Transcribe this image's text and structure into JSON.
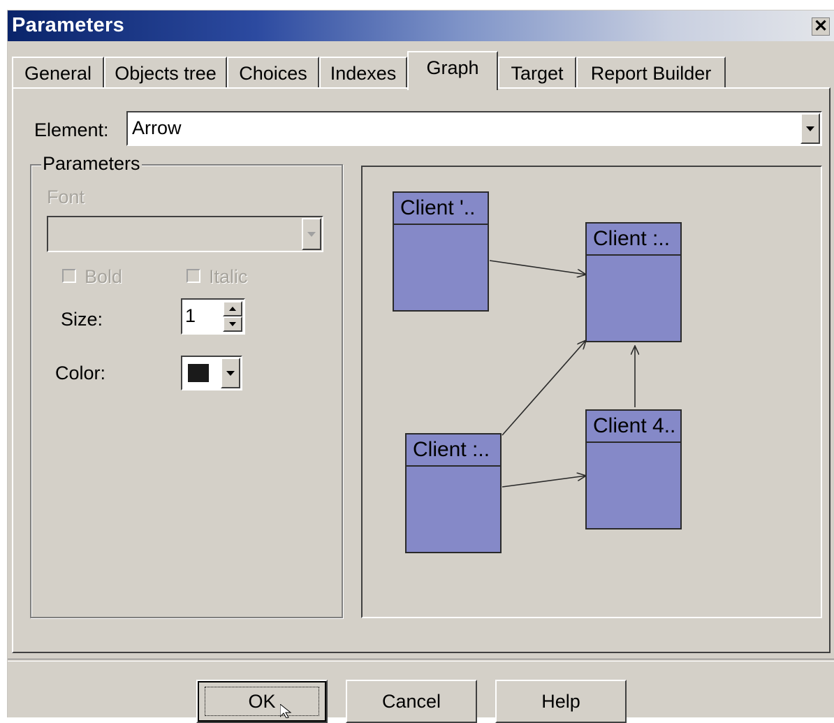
{
  "window": {
    "title": "Parameters",
    "close_glyph": "✕"
  },
  "tabs": [
    {
      "label": "General"
    },
    {
      "label": "Objects tree"
    },
    {
      "label": "Choices"
    },
    {
      "label": "Indexes"
    },
    {
      "label": "Graph"
    },
    {
      "label": "Target"
    },
    {
      "label": "Report Builder"
    }
  ],
  "active_tab": "Graph",
  "element": {
    "label": "Element:",
    "value": "Arrow"
  },
  "parameters_group": {
    "title": "Parameters",
    "font_label": "Font",
    "font_value": "",
    "bold_label": "Bold",
    "italic_label": "Italic",
    "bold_checked": false,
    "italic_checked": false,
    "size_label": "Size:",
    "size_value": "1",
    "color_label": "Color:",
    "color_value": "#1a1a1a"
  },
  "preview": {
    "nodes": [
      {
        "label": "Client '.."
      },
      {
        "label": "Client :.."
      },
      {
        "label": "Client :.."
      },
      {
        "label": "Client 4.."
      }
    ],
    "node_fill": "#8589c8",
    "edge_color": "#2a2a2a"
  },
  "buttons": {
    "ok": "OK",
    "cancel": "Cancel",
    "help": "Help"
  }
}
